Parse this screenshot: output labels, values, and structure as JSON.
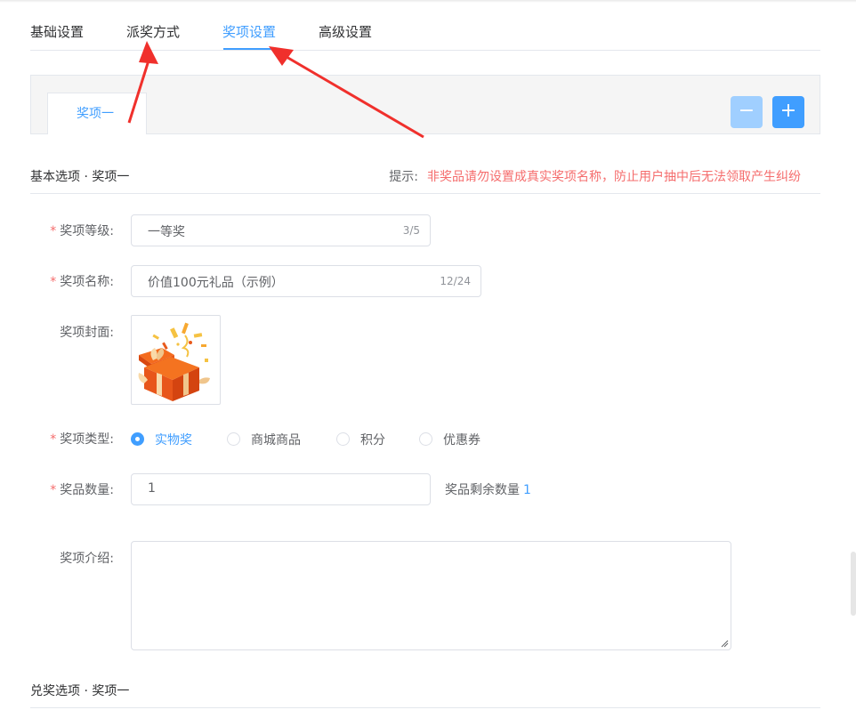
{
  "tabs": [
    {
      "label": "基础设置",
      "active": false
    },
    {
      "label": "派奖方式",
      "active": false
    },
    {
      "label": "奖项设置",
      "active": true
    },
    {
      "label": "高级设置",
      "active": false
    }
  ],
  "prize_tabs": [
    "奖项一"
  ],
  "buttons": {
    "minus": "−",
    "plus": "+"
  },
  "basic_section": {
    "title": "基本选项 · 奖项一",
    "hint_label": "提示:",
    "hint_text": "非奖品请勿设置成真实奖项名称，防止用户抽中后无法领取产生纠纷"
  },
  "form": {
    "level": {
      "label": "奖项等级:",
      "value": "一等奖",
      "count": "3/5"
    },
    "name": {
      "label": "奖项名称:",
      "value": "价值100元礼品（示例）",
      "count": "12/24"
    },
    "cover": {
      "label": "奖项封面:"
    },
    "type": {
      "label": "奖项类型:",
      "options": [
        "实物奖",
        "商城商品",
        "积分",
        "优惠券"
      ],
      "selected": "实物奖"
    },
    "quantity": {
      "label": "奖品数量:",
      "value": "1",
      "remaining_label": "奖品剩余数量",
      "remaining_value": "1"
    },
    "intro": {
      "label": "奖项介绍:",
      "value": ""
    }
  },
  "redeem_section": {
    "title": "兑奖选项 · 奖项一"
  },
  "colors": {
    "primary": "#409eff",
    "primary_light": "#a0cfff",
    "danger": "#f56c6c",
    "arrow": "#f0302c"
  },
  "icons": {
    "cover_image": "gift-box-icon"
  }
}
